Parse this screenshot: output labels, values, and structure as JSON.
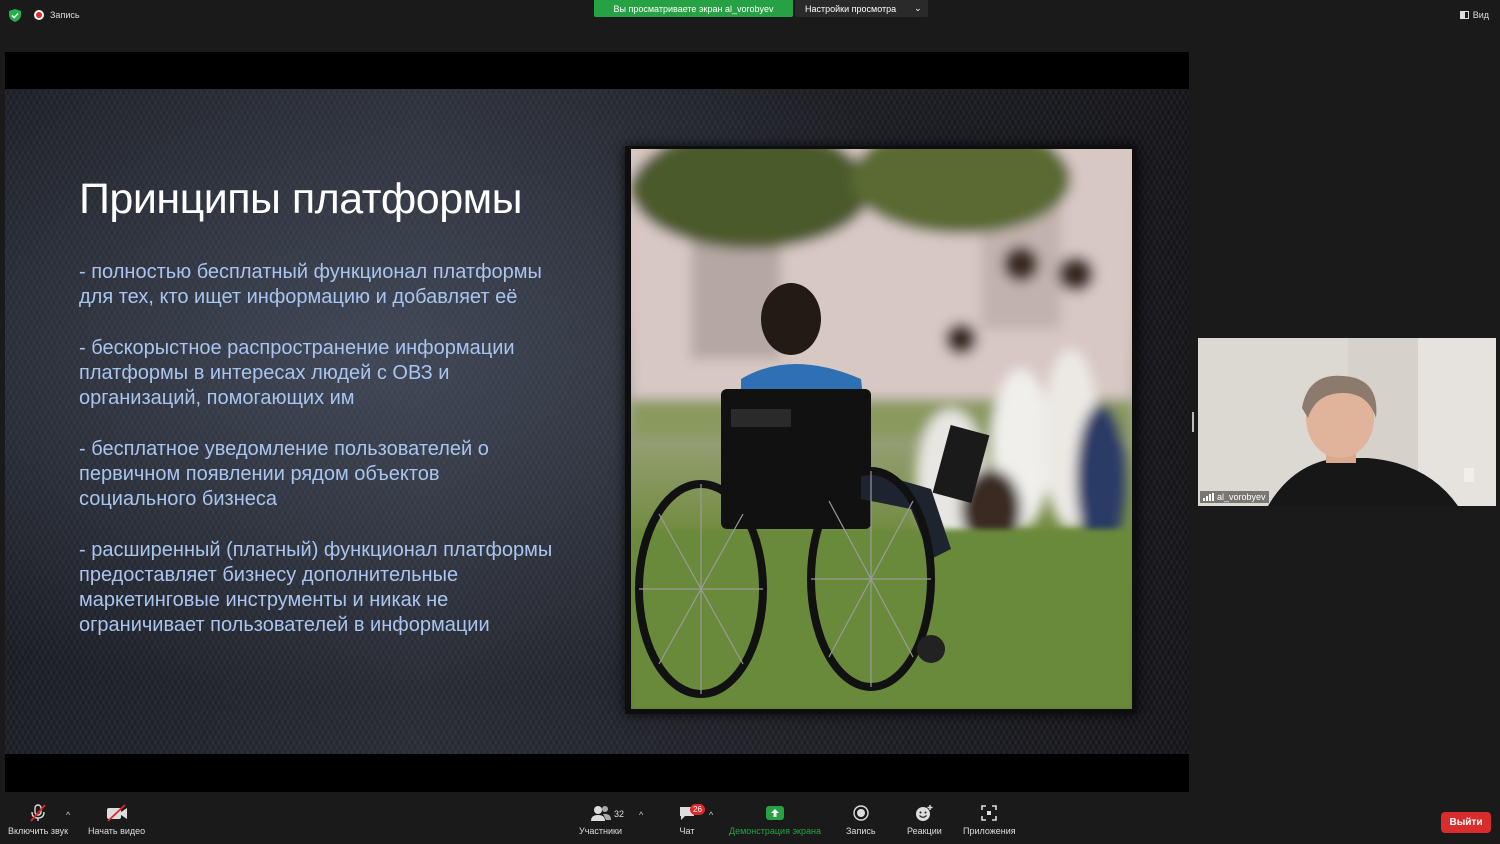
{
  "topbar": {
    "recording_label": "Запись",
    "viewing_label": "Вы просматриваете экран al_vorobyev",
    "view_settings_label": "Настройки просмотра",
    "view_label": "Вид",
    "accent_green": "#26a244"
  },
  "slide": {
    "title": "Принципы платформы",
    "bullets": [
      "- полностью бесплатный функционал платформы для тех, кто ищет информацию и добавляет её",
      "- бескорыстное распространение информации платформы в интересах людей с ОВЗ и организаций, помогающих им",
      "- бесплатное уведомление пользователей о первичном появлении рядом объектов социального бизнеса",
      "- расширенный (платный) функционал платформы предоставляет бизнесу дополнительные маркетинговые инструменты и никак не ограничивает пользователей в информации"
    ],
    "bullet_color": "#a9c5ef"
  },
  "participant": {
    "name": "al_vorobyev"
  },
  "toolbar": {
    "unmute_label": "Включить звук",
    "start_video_label": "Начать видео",
    "participants_label": "Участники",
    "participants_count": "32",
    "chat_label": "Чат",
    "chat_badge": "26",
    "share_label": "Демонстрация экрана",
    "record_label": "Запись",
    "reactions_label": "Реакции",
    "apps_label": "Приложения",
    "exit_label": "Выйти",
    "exit_color": "#d92d2d"
  }
}
